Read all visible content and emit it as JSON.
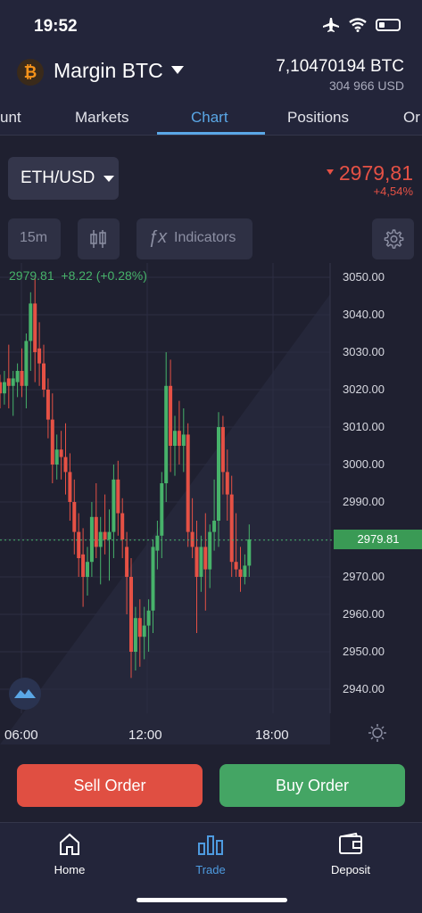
{
  "status_bar": {
    "time": "19:52",
    "icons": [
      "airplane-icon",
      "wifi-icon",
      "battery-icon"
    ]
  },
  "header": {
    "account_title": "Margin BTC",
    "balance_btc": "7,10470194 BTC",
    "balance_usd": "304 966  USD"
  },
  "tabs": [
    {
      "label": "unt",
      "active": false
    },
    {
      "label": "Markets",
      "active": false
    },
    {
      "label": "Chart",
      "active": true
    },
    {
      "label": "Positions",
      "active": false
    },
    {
      "label": "Or",
      "active": false
    }
  ],
  "pair": {
    "label": "ETH/USD",
    "price": "2979,81",
    "change": "+4,54%"
  },
  "toolbar": {
    "interval": "15m",
    "indicators_label": "Indicators"
  },
  "ohlc_info": {
    "price": "2979.81",
    "change": "+8.22 (+0.28%)"
  },
  "colors": {
    "up": "#47b26a",
    "down": "#e55145",
    "accent": "#5aa7e6",
    "background": "#1f2030"
  },
  "chart_data": {
    "type": "candlestick",
    "y_ticks": [
      "3050.00",
      "3040.00",
      "3030.00",
      "3020.00",
      "3010.00",
      "3000.00",
      "2990.00",
      "2980.00",
      "2970.00",
      "2960.00",
      "2950.00",
      "2940.00"
    ],
    "x_ticks": [
      "06:00",
      "12:00",
      "18:00"
    ],
    "ylim": [
      2935,
      3052
    ],
    "last_price": "2979.81",
    "candles": [
      [
        3022,
        3024,
        3015,
        3019
      ],
      [
        3019,
        3025,
        3016,
        3022
      ],
      [
        3023,
        3032,
        3015,
        3021
      ],
      [
        3021,
        3025,
        3013,
        3023
      ],
      [
        3022,
        3027,
        3018,
        3025
      ],
      [
        3025,
        3031,
        3018,
        3021
      ],
      [
        3021,
        3035,
        3015,
        3033
      ],
      [
        3033,
        3046,
        3025,
        3043
      ],
      [
        3043,
        3050,
        3022,
        3030
      ],
      [
        3031,
        3038,
        3021,
        3027
      ],
      [
        3027,
        3032,
        3018,
        3020
      ],
      [
        3020,
        3023,
        3007,
        3012
      ],
      [
        3012,
        3019,
        2995,
        3000
      ],
      [
        3000,
        3008,
        2996,
        3004
      ],
      [
        3004,
        3009,
        2996,
        3002
      ],
      [
        3002,
        3011,
        2992,
        2998
      ],
      [
        2998,
        3003,
        2985,
        2990
      ],
      [
        2990,
        2996,
        2976,
        2982
      ],
      [
        2982,
        2987,
        2970,
        2975
      ],
      [
        2976,
        2983,
        2962,
        2970
      ],
      [
        2970,
        2978,
        2965,
        2974
      ],
      [
        2974,
        2990,
        2970,
        2986
      ],
      [
        2986,
        2995,
        2975,
        2978
      ],
      [
        2978,
        2986,
        2968,
        2982
      ],
      [
        2982,
        2992,
        2976,
        2980
      ],
      [
        2980,
        2988,
        2969,
        2982
      ],
      [
        2982,
        3000,
        2975,
        2996
      ],
      [
        2996,
        3001,
        2981,
        2987
      ],
      [
        2987,
        2991,
        2975,
        2980
      ],
      [
        2978,
        2982,
        2960,
        2970
      ],
      [
        2970,
        2975,
        2943,
        2950
      ],
      [
        2950,
        2962,
        2945,
        2959
      ],
      [
        2959,
        2964,
        2946,
        2954
      ],
      [
        2954,
        2962,
        2948,
        2957
      ],
      [
        2957,
        2964,
        2950,
        2961
      ],
      [
        2961,
        2980,
        2955,
        2978
      ],
      [
        2977,
        2985,
        2972,
        2981
      ],
      [
        2981,
        2998,
        2975,
        2995
      ],
      [
        2995,
        3030,
        2990,
        3021
      ],
      [
        3021,
        3028,
        2998,
        3005
      ],
      [
        3005,
        3013,
        2997,
        3009
      ],
      [
        3009,
        3017,
        3000,
        3005
      ],
      [
        3005,
        3015,
        2998,
        3008
      ],
      [
        3008,
        3011,
        2978,
        2982
      ],
      [
        2982,
        2991,
        2975,
        2978
      ],
      [
        2978,
        2985,
        2955,
        2970
      ],
      [
        2970,
        2981,
        2966,
        2978
      ],
      [
        2978,
        2987,
        2961,
        2972
      ],
      [
        2972,
        2984,
        2967,
        2982
      ],
      [
        2982,
        2996,
        2977,
        2985
      ],
      [
        2985,
        3014,
        2978,
        3010
      ],
      [
        3010,
        3013,
        2992,
        2998
      ],
      [
        2998,
        3004,
        2985,
        2992
      ],
      [
        2992,
        2997,
        2970,
        2974
      ],
      [
        2974,
        2987,
        2970,
        2972
      ],
      [
        2972,
        2978,
        2966,
        2970
      ],
      [
        2970,
        2976,
        2968,
        2973
      ],
      [
        2973,
        2984,
        2970,
        2980
      ]
    ]
  },
  "buttons": {
    "sell": "Sell Order",
    "buy": "Buy Order"
  },
  "bottom_nav": [
    {
      "label": "Home",
      "icon": "home-icon",
      "active": false
    },
    {
      "label": "Trade",
      "icon": "trade-icon",
      "active": true
    },
    {
      "label": "Deposit",
      "icon": "wallet-icon",
      "active": false
    }
  ]
}
